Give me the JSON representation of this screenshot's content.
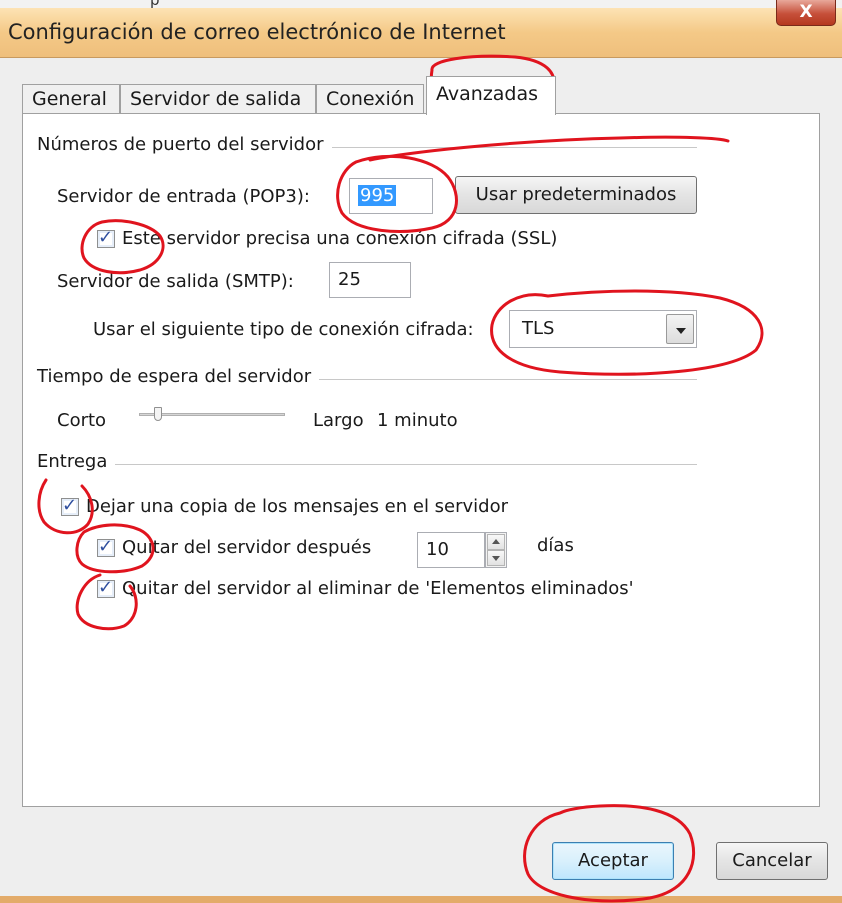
{
  "window": {
    "clipped_text": "p",
    "title": "Configuración de correo electrónico de Internet",
    "close_label": "X"
  },
  "tabs": [
    {
      "label": "General"
    },
    {
      "label": "Servidor de salida"
    },
    {
      "label": "Conexión"
    },
    {
      "label": "Avanzadas",
      "active": true
    }
  ],
  "ports": {
    "group_label": "Números de puerto del servidor",
    "incoming_label": "Servidor de entrada (POP3):",
    "incoming_value": "995",
    "defaults_button": "Usar predeterminados",
    "ssl_checkbox_label": "Este servidor precisa una conexión cifrada (SSL)",
    "ssl_checked": true,
    "outgoing_label": "Servidor de salida (SMTP):",
    "outgoing_value": "25",
    "encryption_label": "Usar el siguiente tipo de conexión cifrada:",
    "encryption_value": "TLS"
  },
  "timeout": {
    "group_label": "Tiempo de espera del servidor",
    "short_label": "Corto",
    "long_label": "Largo",
    "value_label": "1 minuto",
    "slider_level": 0.1
  },
  "delivery": {
    "group_label": "Entrega",
    "leave_copy_label": "Dejar una copia de los mensajes en el servidor",
    "leave_copy_checked": true,
    "remove_after_label": "Quitar del servidor después",
    "remove_after_checked": true,
    "remove_after_days": "10",
    "days_label": "días",
    "remove_deleted_label": "Quitar del servidor al eliminar de 'Elementos eliminados'",
    "remove_deleted_checked": true
  },
  "buttons": {
    "accept": "Aceptar",
    "cancel": "Cancelar"
  },
  "colors": {
    "annotation_ink": "#e0141e",
    "titlebar": "#f4c987",
    "selection": "#3399ff"
  },
  "icons": [
    "close-icon",
    "checkmark-icon",
    "dropdown-arrow-icon",
    "spin-up-icon",
    "spin-down-icon",
    "slider-thumb-icon"
  ]
}
